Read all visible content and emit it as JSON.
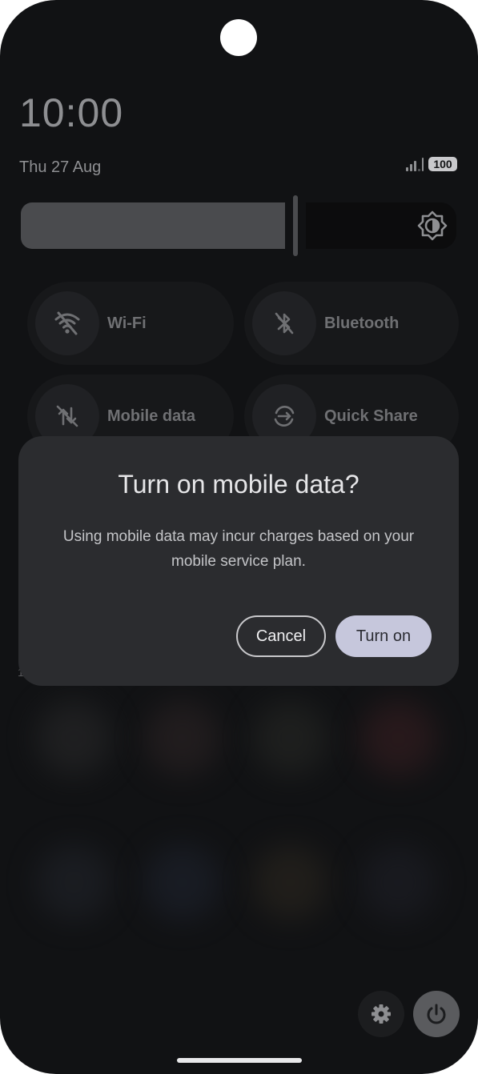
{
  "status_bar": {
    "time": "10:00",
    "date": "Thu 27 Aug",
    "battery": "100"
  },
  "brightness": {
    "level": 0.6,
    "icon": "brightness-auto-icon"
  },
  "tiles": [
    {
      "label": "Wi-Fi",
      "icon": "wifi-off-icon"
    },
    {
      "label": "Bluetooth",
      "icon": "bluetooth-off-icon"
    },
    {
      "label": "Mobile data",
      "icon": "mobile-data-off-icon"
    },
    {
      "label": "Quick Share",
      "icon": "quick-share-icon"
    }
  ],
  "dialog": {
    "title": "Turn on mobile data?",
    "message": "Using mobile data may incur charges based on your mobile service plan.",
    "cancel_label": "Cancel",
    "confirm_label": "Turn on"
  },
  "bottom": {
    "settings_icon": "gear-icon",
    "power_icon": "power-icon"
  },
  "colors": {
    "background": "#111214",
    "dialog": "#2b2c2f",
    "confirm_button": "#c6c7dc"
  }
}
